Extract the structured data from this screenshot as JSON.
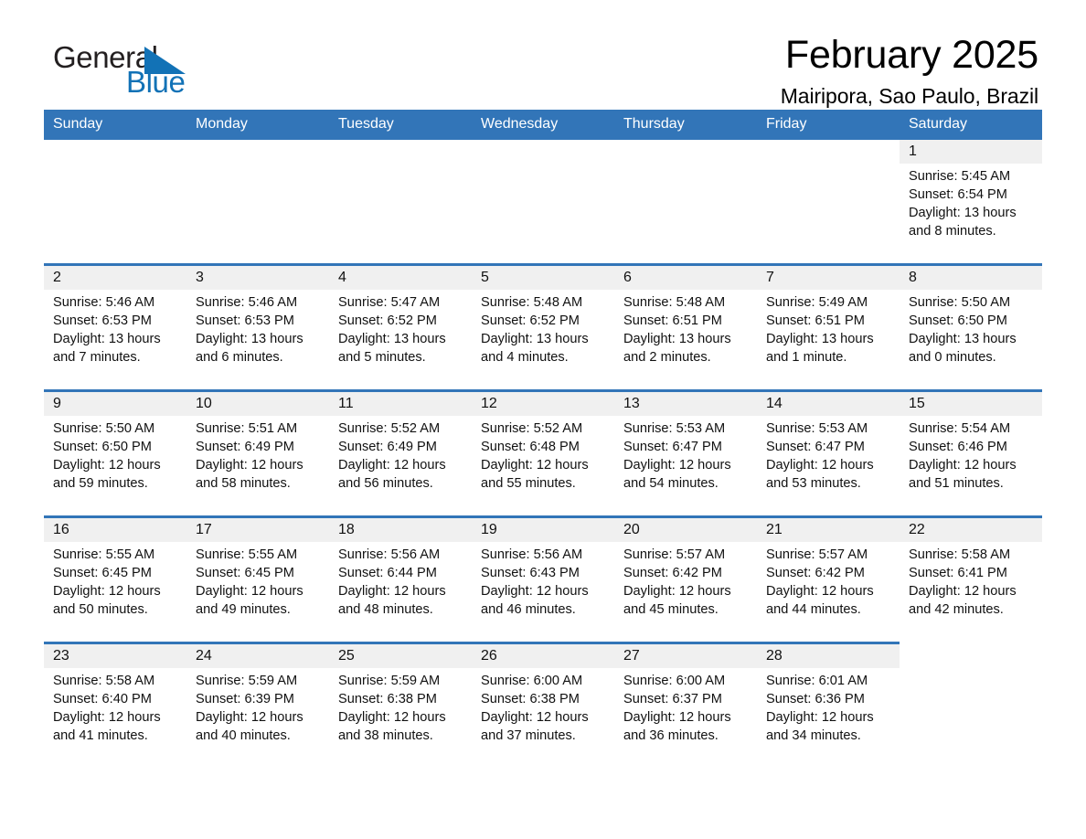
{
  "brand": {
    "name_part1": "General",
    "name_part2": "Blue",
    "logo_icon": "triangle-flag-icon",
    "accent_color": "#1272b6"
  },
  "header": {
    "month_title": "February 2025",
    "location": "Mairipora, Sao Paulo, Brazil"
  },
  "calendar": {
    "header_bg": "#3275b8",
    "daynum_bg": "#f0f0f0",
    "weekdays": [
      "Sunday",
      "Monday",
      "Tuesday",
      "Wednesday",
      "Thursday",
      "Friday",
      "Saturday"
    ],
    "weeks": [
      [
        {
          "day": "",
          "sunrise": "",
          "sunset": "",
          "daylight": "",
          "empty": true
        },
        {
          "day": "",
          "sunrise": "",
          "sunset": "",
          "daylight": "",
          "empty": true
        },
        {
          "day": "",
          "sunrise": "",
          "sunset": "",
          "daylight": "",
          "empty": true
        },
        {
          "day": "",
          "sunrise": "",
          "sunset": "",
          "daylight": "",
          "empty": true
        },
        {
          "day": "",
          "sunrise": "",
          "sunset": "",
          "daylight": "",
          "empty": true
        },
        {
          "day": "",
          "sunrise": "",
          "sunset": "",
          "daylight": "",
          "empty": true
        },
        {
          "day": "1",
          "sunrise": "Sunrise: 5:45 AM",
          "sunset": "Sunset: 6:54 PM",
          "daylight": "Daylight: 13 hours and 8 minutes.",
          "empty": false
        }
      ],
      [
        {
          "day": "2",
          "sunrise": "Sunrise: 5:46 AM",
          "sunset": "Sunset: 6:53 PM",
          "daylight": "Daylight: 13 hours and 7 minutes.",
          "empty": false
        },
        {
          "day": "3",
          "sunrise": "Sunrise: 5:46 AM",
          "sunset": "Sunset: 6:53 PM",
          "daylight": "Daylight: 13 hours and 6 minutes.",
          "empty": false
        },
        {
          "day": "4",
          "sunrise": "Sunrise: 5:47 AM",
          "sunset": "Sunset: 6:52 PM",
          "daylight": "Daylight: 13 hours and 5 minutes.",
          "empty": false
        },
        {
          "day": "5",
          "sunrise": "Sunrise: 5:48 AM",
          "sunset": "Sunset: 6:52 PM",
          "daylight": "Daylight: 13 hours and 4 minutes.",
          "empty": false
        },
        {
          "day": "6",
          "sunrise": "Sunrise: 5:48 AM",
          "sunset": "Sunset: 6:51 PM",
          "daylight": "Daylight: 13 hours and 2 minutes.",
          "empty": false
        },
        {
          "day": "7",
          "sunrise": "Sunrise: 5:49 AM",
          "sunset": "Sunset: 6:51 PM",
          "daylight": "Daylight: 13 hours and 1 minute.",
          "empty": false
        },
        {
          "day": "8",
          "sunrise": "Sunrise: 5:50 AM",
          "sunset": "Sunset: 6:50 PM",
          "daylight": "Daylight: 13 hours and 0 minutes.",
          "empty": false
        }
      ],
      [
        {
          "day": "9",
          "sunrise": "Sunrise: 5:50 AM",
          "sunset": "Sunset: 6:50 PM",
          "daylight": "Daylight: 12 hours and 59 minutes.",
          "empty": false
        },
        {
          "day": "10",
          "sunrise": "Sunrise: 5:51 AM",
          "sunset": "Sunset: 6:49 PM",
          "daylight": "Daylight: 12 hours and 58 minutes.",
          "empty": false
        },
        {
          "day": "11",
          "sunrise": "Sunrise: 5:52 AM",
          "sunset": "Sunset: 6:49 PM",
          "daylight": "Daylight: 12 hours and 56 minutes.",
          "empty": false
        },
        {
          "day": "12",
          "sunrise": "Sunrise: 5:52 AM",
          "sunset": "Sunset: 6:48 PM",
          "daylight": "Daylight: 12 hours and 55 minutes.",
          "empty": false
        },
        {
          "day": "13",
          "sunrise": "Sunrise: 5:53 AM",
          "sunset": "Sunset: 6:47 PM",
          "daylight": "Daylight: 12 hours and 54 minutes.",
          "empty": false
        },
        {
          "day": "14",
          "sunrise": "Sunrise: 5:53 AM",
          "sunset": "Sunset: 6:47 PM",
          "daylight": "Daylight: 12 hours and 53 minutes.",
          "empty": false
        },
        {
          "day": "15",
          "sunrise": "Sunrise: 5:54 AM",
          "sunset": "Sunset: 6:46 PM",
          "daylight": "Daylight: 12 hours and 51 minutes.",
          "empty": false
        }
      ],
      [
        {
          "day": "16",
          "sunrise": "Sunrise: 5:55 AM",
          "sunset": "Sunset: 6:45 PM",
          "daylight": "Daylight: 12 hours and 50 minutes.",
          "empty": false
        },
        {
          "day": "17",
          "sunrise": "Sunrise: 5:55 AM",
          "sunset": "Sunset: 6:45 PM",
          "daylight": "Daylight: 12 hours and 49 minutes.",
          "empty": false
        },
        {
          "day": "18",
          "sunrise": "Sunrise: 5:56 AM",
          "sunset": "Sunset: 6:44 PM",
          "daylight": "Daylight: 12 hours and 48 minutes.",
          "empty": false
        },
        {
          "day": "19",
          "sunrise": "Sunrise: 5:56 AM",
          "sunset": "Sunset: 6:43 PM",
          "daylight": "Daylight: 12 hours and 46 minutes.",
          "empty": false
        },
        {
          "day": "20",
          "sunrise": "Sunrise: 5:57 AM",
          "sunset": "Sunset: 6:42 PM",
          "daylight": "Daylight: 12 hours and 45 minutes.",
          "empty": false
        },
        {
          "day": "21",
          "sunrise": "Sunrise: 5:57 AM",
          "sunset": "Sunset: 6:42 PM",
          "daylight": "Daylight: 12 hours and 44 minutes.",
          "empty": false
        },
        {
          "day": "22",
          "sunrise": "Sunrise: 5:58 AM",
          "sunset": "Sunset: 6:41 PM",
          "daylight": "Daylight: 12 hours and 42 minutes.",
          "empty": false
        }
      ],
      [
        {
          "day": "23",
          "sunrise": "Sunrise: 5:58 AM",
          "sunset": "Sunset: 6:40 PM",
          "daylight": "Daylight: 12 hours and 41 minutes.",
          "empty": false
        },
        {
          "day": "24",
          "sunrise": "Sunrise: 5:59 AM",
          "sunset": "Sunset: 6:39 PM",
          "daylight": "Daylight: 12 hours and 40 minutes.",
          "empty": false
        },
        {
          "day": "25",
          "sunrise": "Sunrise: 5:59 AM",
          "sunset": "Sunset: 6:38 PM",
          "daylight": "Daylight: 12 hours and 38 minutes.",
          "empty": false
        },
        {
          "day": "26",
          "sunrise": "Sunrise: 6:00 AM",
          "sunset": "Sunset: 6:38 PM",
          "daylight": "Daylight: 12 hours and 37 minutes.",
          "empty": false
        },
        {
          "day": "27",
          "sunrise": "Sunrise: 6:00 AM",
          "sunset": "Sunset: 6:37 PM",
          "daylight": "Daylight: 12 hours and 36 minutes.",
          "empty": false
        },
        {
          "day": "28",
          "sunrise": "Sunrise: 6:01 AM",
          "sunset": "Sunset: 6:36 PM",
          "daylight": "Daylight: 12 hours and 34 minutes.",
          "empty": false
        },
        {
          "day": "",
          "sunrise": "",
          "sunset": "",
          "daylight": "",
          "empty": true
        }
      ]
    ]
  }
}
